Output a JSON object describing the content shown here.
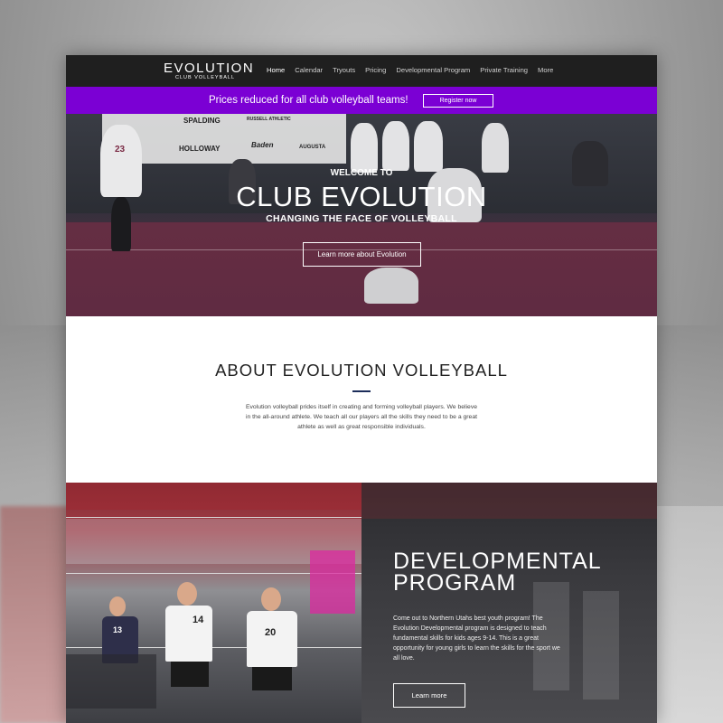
{
  "nav": {
    "logo_main": "EVOLUTION",
    "logo_sub": "CLUB VOLLEYBALL",
    "items": [
      "Home",
      "Calendar",
      "Tryouts",
      "Pricing",
      "Developmental Program",
      "Private Training",
      "More"
    ]
  },
  "promo": {
    "text": "Prices reduced for all club volleyball teams!",
    "button": "Register now"
  },
  "hero": {
    "welcome": "WELCOME TO",
    "title": "CLUB EVOLUTION",
    "subtitle": "CHANGING THE FACE OF VOLLEYBALL",
    "button": "Learn more about Evolution",
    "sponsors": [
      "SPALDING",
      "HOLLOWAY",
      "Baden",
      "AUGUSTA",
      "RUSSELL ATHLETIC"
    ],
    "jersey_numbers": [
      "23"
    ]
  },
  "about": {
    "title": "ABOUT EVOLUTION VOLLEYBALL",
    "body": "Evolution volleyball prides itself in creating and forming volleyball players. We believe in the all-around athlete.  We teach all our players all the skills they need to be a great athlete as well as great responsible individuals."
  },
  "dev": {
    "title_line1": "DEVELOPMENTAL",
    "title_line2": "PROGRAM",
    "body": "Come out to Northern Utahs best youth program! The Evolution Developmental program is designed to teach fundamental skills for kids ages 9-14. This is a great opportunity for young girls to learn the skills for the sport we all love.",
    "button": "Learn more",
    "jersey_numbers": [
      "14",
      "20",
      "13"
    ]
  },
  "colors": {
    "nav_bg": "#1f1f1f",
    "promo_bg": "#7b00d4",
    "accent_rule": "#1c2d5a"
  }
}
